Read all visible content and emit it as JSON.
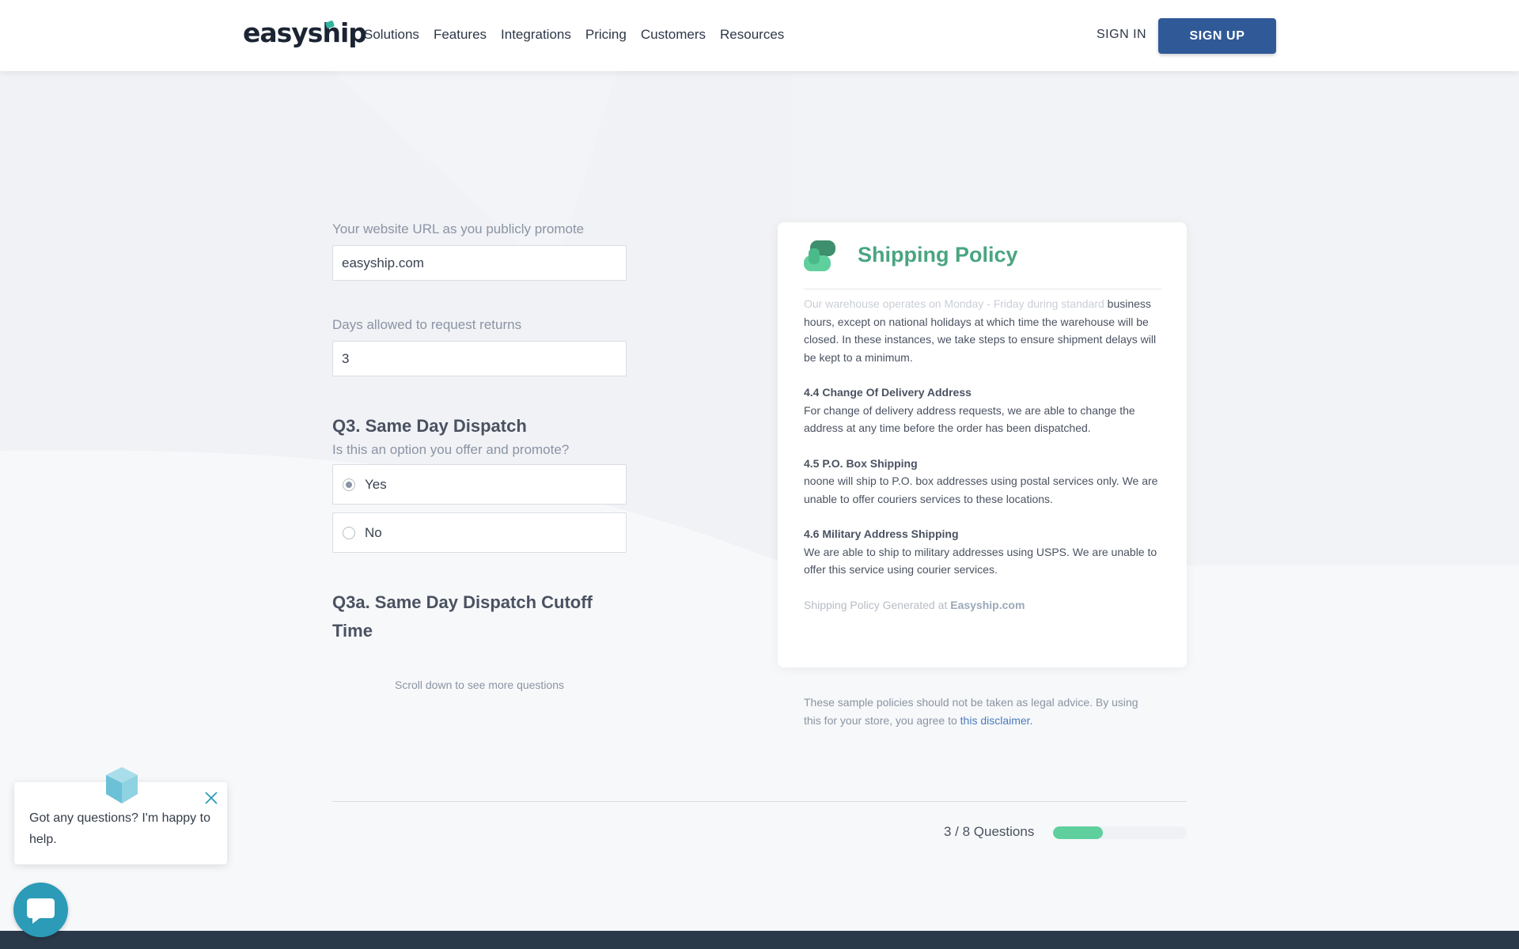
{
  "header": {
    "logo_text": "easyship",
    "nav": [
      "Solutions",
      "Features",
      "Integrations",
      "Pricing",
      "Customers",
      "Resources"
    ],
    "sign_in": "SIGN IN",
    "sign_up": "SIGN UP"
  },
  "form": {
    "website_label": "Your website URL as you publicly promote",
    "website_value": "easyship.com",
    "returns_label": "Days allowed to request returns",
    "returns_value": "3",
    "q3_title": "Q3. Same Day Dispatch",
    "q3_sub": "Is this an option you offer and promote?",
    "options": [
      {
        "label": "Yes",
        "selected": true
      },
      {
        "label": "No",
        "selected": false
      }
    ],
    "q3a_title": "Q3a. Same Day Dispatch Cutoff Time",
    "scroll_hint": "Scroll down to see more questions"
  },
  "policy": {
    "title": "Shipping Policy",
    "intro_faded": "Our warehouse operates on Monday - Friday during standard",
    "intro_rest": "business hours, except on national holidays at which time the warehouse will be closed. In these instances, we take steps to ensure shipment delays will be kept to a minimum.",
    "sections": [
      {
        "heading": "4.4 Change Of Delivery Address",
        "body": "For change of delivery address requests, we are able to change the address at any time before the order has been dispatched."
      },
      {
        "heading": "4.5 P.O. Box Shipping",
        "body": "noone will ship to P.O. box addresses using postal services only. We are unable to offer couriers services to these locations."
      },
      {
        "heading": "4.6 Military Address Shipping",
        "body": "We are able to ship to military addresses using USPS. We are unable to offer this service using courier services."
      }
    ],
    "footer_prefix": "Shipping Policy Generated at",
    "footer_link": "Easyship.com"
  },
  "disclaimer": {
    "text": "These sample policies should not be taken as legal advice. By using this for your store, you agree to",
    "link": "this disclaimer."
  },
  "progress": {
    "text": "3 / 8 Questions",
    "fraction": 0.375
  },
  "chat": {
    "message": "Got any questions? I'm happy to help."
  },
  "colors": {
    "accent": "#305a97",
    "policy_green": "#4aa581",
    "progress_green": "#5fd09d",
    "chat_teal": "#2b9bb8"
  }
}
